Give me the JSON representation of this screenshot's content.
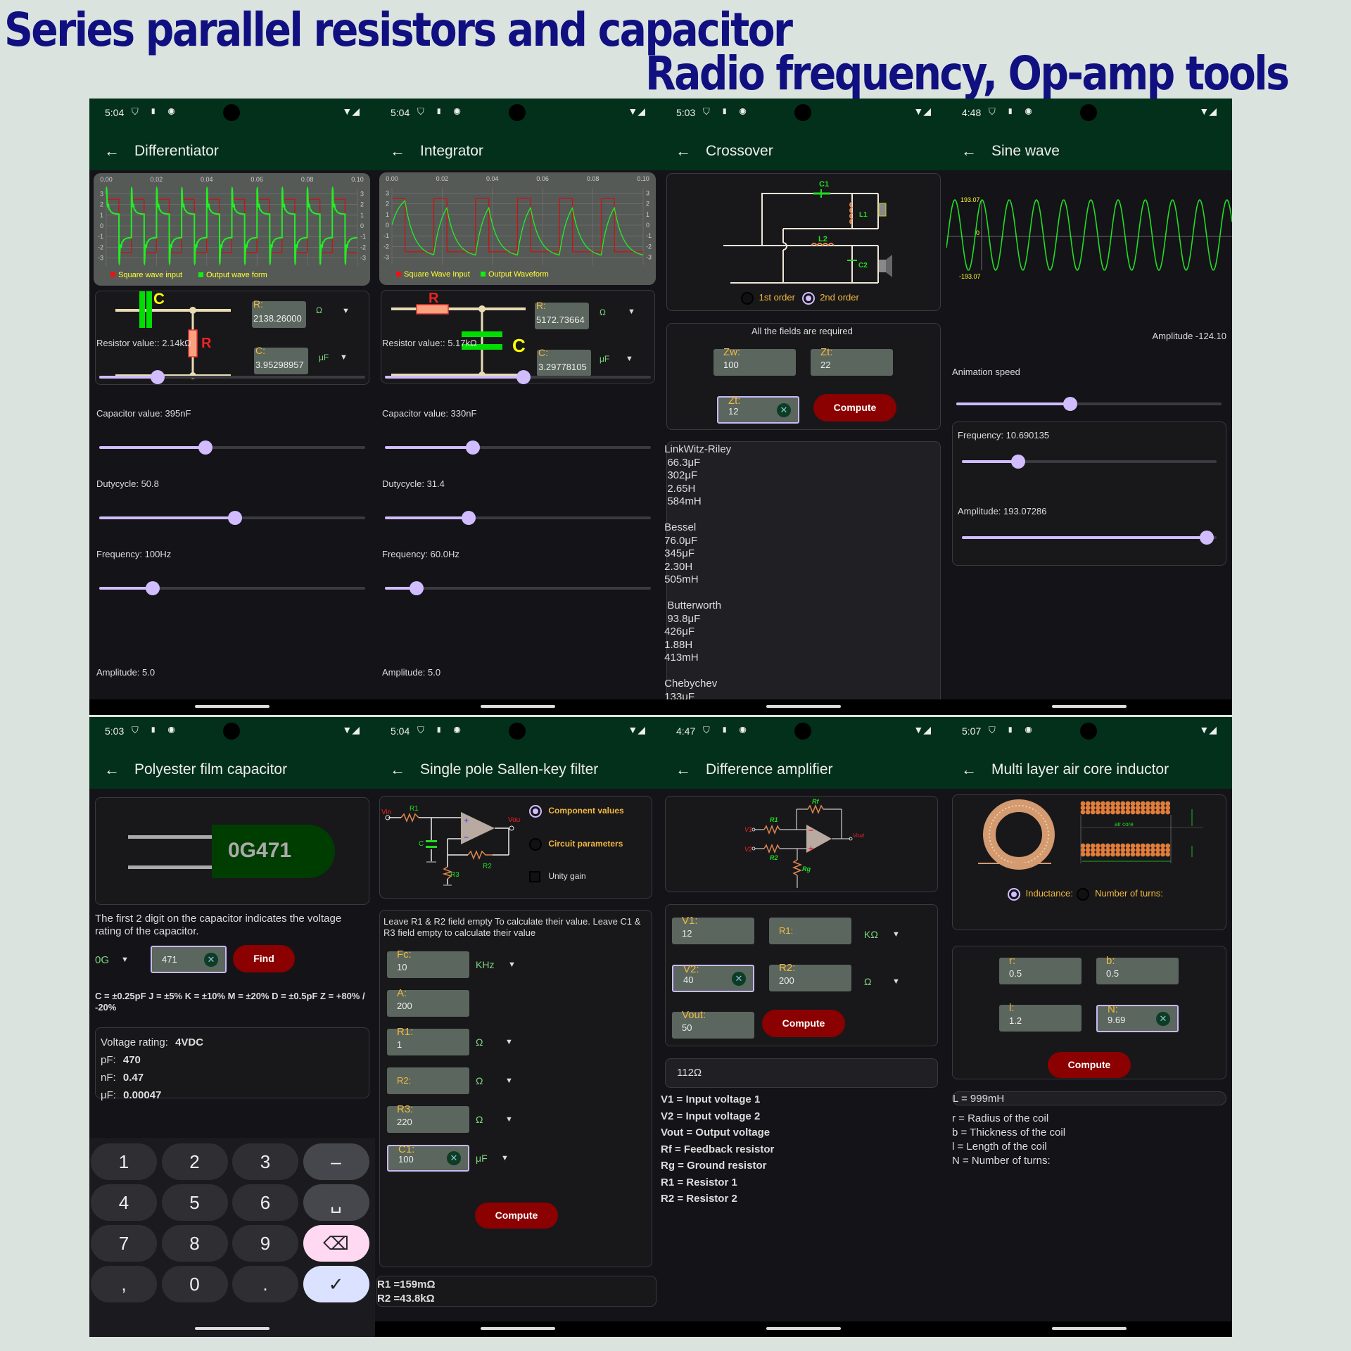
{
  "banner": {
    "line1": "Series parallel resistors and capacitor",
    "line2": "Radio frequency, Op-amp tools"
  },
  "colors": {
    "appbar": "#03301b",
    "accent": "#d0bcff",
    "button": "#8b0000",
    "label": "#f4b93e",
    "unit": "#7ed67e",
    "wave_green": "#00ff00",
    "wave_red": "#dd1111"
  },
  "screens": {
    "differentiator": {
      "time": "5:04",
      "title": "Differentiator",
      "legend_input": "Square wave input",
      "legend_output": "Output wave form",
      "r_label": "R:",
      "r_value": "2138.26000",
      "r_unit": "Ω",
      "c_label": "C:",
      "c_value": "3.95298957",
      "c_unit": "μF",
      "sym_c": "C",
      "sym_r": "R",
      "sliders": [
        {
          "label": "Resistor value:: 2.14kΩ",
          "fraction": 0.22
        },
        {
          "label": "Capacitor value: 395nF",
          "fraction": 0.4
        },
        {
          "label": "Dutycycle: 50.8",
          "fraction": 0.51
        },
        {
          "label": "Frequency: 100Hz",
          "fraction": 0.2
        }
      ],
      "amplitude_label": "Amplitude: 5.0"
    },
    "integrator": {
      "time": "5:04",
      "title": "Integrator",
      "legend_input": "Square Wave Input",
      "legend_output": "Output Waveform",
      "r_label": "R:",
      "r_value": "5172.73664",
      "r_unit": "Ω",
      "c_label": "C:",
      "c_value": "3.29778105",
      "c_unit": "μF",
      "sym_c": "C",
      "sym_r": "R",
      "sliders": [
        {
          "label": "Resistor value:: 5.17kΩ",
          "fraction": 0.52
        },
        {
          "label": "Capacitor value: 330nF",
          "fraction": 0.33
        },
        {
          "label": "Dutycycle: 31.4",
          "fraction": 0.314
        },
        {
          "label": "Frequency: 60.0Hz",
          "fraction": 0.12
        }
      ],
      "amplitude_label": "Amplitude: 5.0"
    },
    "crossover": {
      "time": "5:03",
      "title": "Crossover",
      "labels": {
        "c1": "C1",
        "l1": "L1",
        "l2": "L2",
        "c2": "C2"
      },
      "order_options": [
        {
          "label": "1st order",
          "selected": false
        },
        {
          "label": "2nd order",
          "selected": true
        }
      ],
      "required_note": "All the fields are required",
      "zw_label": "Zw:",
      "zw_value": "100",
      "zt1_label": "Zt:",
      "zt1_value": "22",
      "zt2_label": "Zt:",
      "zt2_value": "12",
      "compute": "Compute",
      "results": " LinkWitz-Riley\n  66.3μF\n  302μF\n  2.65H\n  584mH\n\n Bessel\n 76.0μF\n 345μF\n 2.30H\n 505mH\n\n  Butterworth\n  93.8μF\n 426μF\n 1.88H\n 413mH\n\n Chebychev\n 133μF"
    },
    "sine": {
      "time": "4:48",
      "title": "Sine wave",
      "max_label": "193.07",
      "zero_label": "0",
      "min_label": "-193.07",
      "amplitude_readout": "Amplitude -124.10",
      "speed_label": "Animation speed",
      "speed_fraction": 0.43,
      "frequency_label": "Frequency: 10.690135",
      "frequency_fraction": 0.22,
      "amplitude_label": "Amplitude: 193.07286",
      "amplitude_fraction": 0.96
    },
    "polyester": {
      "time": "5:03",
      "title": "Polyester film capacitor",
      "cap_code": "0G471",
      "info": "The first 2 digit on the capacitor indicates the voltage rating of the capacitor.",
      "voltage_code": "0G",
      "code_input": "471",
      "find": "Find",
      "tolerance": "C = ±0.25pF J = ±5% K = ±10% M = ±20% D = ±0.5pF Z = +80% / -20%",
      "results": [
        {
          "k": "Voltage rating:",
          "v": "4VDC"
        },
        {
          "k": "pF:",
          "v": "470"
        },
        {
          "k": "nF:",
          "v": "0.47"
        },
        {
          "k": "μF:",
          "v": "0.00047"
        }
      ],
      "keys": [
        "1",
        "2",
        "3",
        "–",
        "4",
        "5",
        "6",
        "␣",
        "7",
        "8",
        "9",
        "⌫",
        ",",
        "0",
        ".",
        "✓"
      ]
    },
    "sallen": {
      "time": "5:04",
      "title": "Single pole Sallen-key filter",
      "options": [
        {
          "label": "Component values",
          "selected": true
        },
        {
          "label": "Circuit parameters",
          "selected": false
        }
      ],
      "unity_gain": "Unity gain",
      "note": "Leave R1 & R2 field empty To calculate their value. Leave C1 & R3 field empty to calculate their value",
      "fields": [
        {
          "label": "Fc:",
          "value": "10",
          "unit": "KHz"
        },
        {
          "label": "A:",
          "value": "200",
          "unit": ""
        },
        {
          "label": "R1:",
          "value": "1",
          "unit": "Ω"
        },
        {
          "label": "R2:",
          "value": "",
          "unit": "Ω"
        },
        {
          "label": "R3:",
          "value": "220",
          "unit": "Ω"
        },
        {
          "label": "C1:",
          "value": "100",
          "unit": "μF"
        }
      ],
      "compute": "Compute",
      "result1": "R1 =159mΩ",
      "result2": "R2 =43.8kΩ"
    },
    "difference": {
      "time": "4:47",
      "title": "Difference amplifier",
      "v1_label": "V1:",
      "v1_value": "12",
      "r1_label": "R1:",
      "r1_value": "",
      "r1_unit": "KΩ",
      "v2_label": "V2:",
      "v2_value": "40",
      "r2_label": "R2:",
      "r2_value": "200",
      "r2_unit": "Ω",
      "vout_label": "Vout:",
      "vout_value": "50",
      "compute": "Compute",
      "result": "112Ω",
      "legend": [
        "V1 = Input voltage 1",
        "V2 = Input voltage 2",
        "Vout = Output voltage",
        "Rf = Feedback resistor",
        "Rg = Ground resistor",
        "R1 = Resistor 1",
        "R2 = Resistor 2"
      ]
    },
    "inductor": {
      "time": "5:07",
      "title": "Multi layer air core inductor",
      "air_core": "air core",
      "options": [
        {
          "label": "Inductance:",
          "selected": true
        },
        {
          "label": "Number of turns:",
          "selected": false
        }
      ],
      "r_label": "r:",
      "r_value": "0.5",
      "b_label": "b:",
      "b_value": "0.5",
      "l_label": "l:",
      "l_value": "1.2",
      "n_label": "N:",
      "n_value": "9.69",
      "compute": "Compute",
      "result": "L = 999mH",
      "legend": [
        "r = Radius of the coil",
        "b = Thickness of the coil",
        "l = Length of the coil",
        "N = Number of turns:"
      ]
    }
  },
  "chart_data": [
    {
      "type": "line",
      "title": "Differentiator",
      "x_ticks": [
        "0.00",
        "0.02",
        "0.04",
        "0.06",
        "0.08",
        "0.10"
      ],
      "y_ticks": [
        "3",
        "2",
        "1",
        "0",
        "-1",
        "-2",
        "-3"
      ],
      "xlim": [
        0,
        0.1
      ],
      "ylim": [
        -3.5,
        3.5
      ],
      "series": [
        {
          "name": "Square wave input",
          "kind": "square",
          "amplitude": 2.5,
          "frequency_hz": 100,
          "duty": 0.508
        },
        {
          "name": "Output wave form",
          "kind": "differentiated-spike",
          "peak": 3.0,
          "settle": 1.1
        }
      ],
      "legend": "bottom"
    },
    {
      "type": "line",
      "title": "Integrator",
      "x_ticks": [
        "0.00",
        "0.02",
        "0.04",
        "0.06",
        "0.08",
        "0.10"
      ],
      "y_ticks": [
        "3",
        "2",
        "1",
        "0",
        "-1",
        "-2",
        "-3"
      ],
      "xlim": [
        0,
        0.1
      ],
      "ylim": [
        -3.5,
        3.5
      ],
      "series": [
        {
          "name": "Square Wave Input",
          "kind": "square",
          "amplitude": 2.5,
          "frequency_hz": 60,
          "duty": 0.314
        },
        {
          "name": "Output Waveform",
          "kind": "rc-charge",
          "peak": 2.5,
          "trough": -2.9
        }
      ],
      "legend": "bottom"
    },
    {
      "type": "line",
      "title": "Sine wave",
      "y_ticks": [
        "193.07",
        "0",
        "-193.07"
      ],
      "ylim": [
        -193.07,
        193.07
      ],
      "series": [
        {
          "name": "sine",
          "amplitude": 193.07,
          "cycles_visible": 10.5
        }
      ]
    }
  ]
}
